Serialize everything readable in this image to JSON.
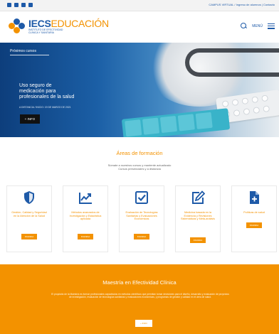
{
  "topbar": {
    "social": [
      "facebook-icon",
      "youtube-icon",
      "linkedin-icon",
      "twitter-icon"
    ],
    "campus_link": "CAMPUS VIRTUAL / Ingreso de alumnos  |  Contacto"
  },
  "header": {
    "brand_prefix": "IECS",
    "brand_suffix": "EDUCACIÓN",
    "brand_subtitle": "INSTITUTO DE EFECTIVIDAD CLÍNICA Y SANITARIA",
    "menu_label": "MENÚ"
  },
  "hero": {
    "next_courses": "Próximos cursos",
    "title": "Uso seguro de medicación para profesionales de la salud",
    "date": "A DISTANCIA / INICIO: 19 DE MARZO DE 2021",
    "cta": "+ INFO"
  },
  "training": {
    "title": "Áreas de formación",
    "subtitle_line1": "Súmate a nuestros cursos y mantente actualizado",
    "subtitle_line2": "Cursos presenciales y a distancia",
    "cards": [
      {
        "icon": "shield-icon",
        "label": "Gestión, Calidad y Seguridad en la Atención de la Salud",
        "button": "INGRESA"
      },
      {
        "icon": "chart-line-icon",
        "label": "Métodos avanzados de Investigación y Estadística aplicada",
        "button": "INGRESA"
      },
      {
        "icon": "checkbox-icon",
        "label": "Evaluación de Tecnologías Sanitarias y Evaluaciones Económicas",
        "button": "INGRESA"
      },
      {
        "icon": "edit-icon",
        "label": "Medicina basada en la Evidencia y Revisiones Sistemáticas y Meta-análisis",
        "button": "INGRESA"
      },
      {
        "icon": "document-plus-icon",
        "label": "Políticas de salud",
        "button": "INGRESA"
      }
    ]
  },
  "master": {
    "title": "Maestría en Efectividad Clínica",
    "description": "El propósito de la Maestría es formar profesionales capacitados en métodos científicos que permitan tomar decisiones para el diseño, desarrollo y evaluación de proyectos de investigación, evaluación de tecnologías sanitarias y evaluaciones económicas, y programas de gestión y calidad en el área de salud.",
    "cta": "+ INFO"
  },
  "colors": {
    "brand_blue": "#1e5aa8",
    "brand_orange": "#f39200"
  }
}
